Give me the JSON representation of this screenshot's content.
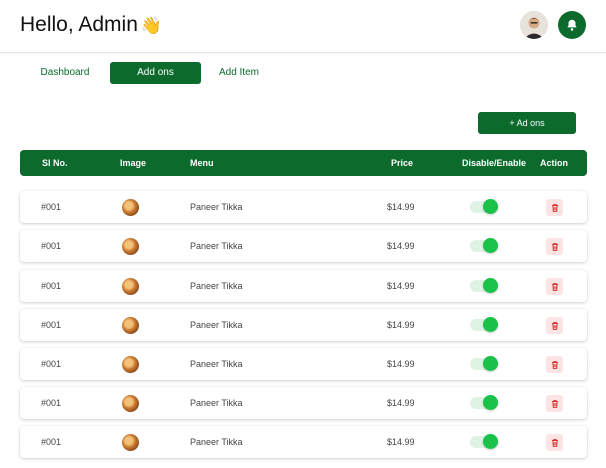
{
  "header": {
    "greeting": "Hello, Admin",
    "wave_emoji": "👋"
  },
  "tabs": [
    {
      "label": "Dashboard",
      "active": false
    },
    {
      "label": "Add ons",
      "active": true
    },
    {
      "label": "Add Item",
      "active": false
    }
  ],
  "toolbar": {
    "add_label": "+  Ad ons"
  },
  "table": {
    "columns": [
      "Sl No.",
      "Image",
      "Menu",
      "Price",
      "Disable/Enable",
      "Action"
    ],
    "rows": [
      {
        "id": "#001",
        "menu": "Paneer Tikka",
        "price": "$14.99",
        "enabled": true
      },
      {
        "id": "#001",
        "menu": "Paneer Tikka",
        "price": "$14.99",
        "enabled": true
      },
      {
        "id": "#001",
        "menu": "Paneer Tikka",
        "price": "$14.99",
        "enabled": true
      },
      {
        "id": "#001",
        "menu": "Paneer Tikka",
        "price": "$14.99",
        "enabled": true
      },
      {
        "id": "#001",
        "menu": "Paneer Tikka",
        "price": "$14.99",
        "enabled": true
      },
      {
        "id": "#001",
        "menu": "Paneer Tikka",
        "price": "$14.99",
        "enabled": true
      },
      {
        "id": "#001",
        "menu": "Paneer Tikka",
        "price": "$14.99",
        "enabled": true
      }
    ]
  },
  "icons": {
    "bell": "bell-icon",
    "avatar": "user-avatar",
    "row_image": "food-thumbnail",
    "delete": "trash-icon"
  },
  "colors": {
    "brand_green": "#0b6a2c",
    "toggle_on": "#1bc24a",
    "toggle_track": "#dff3e4",
    "delete_icon": "#d63030",
    "delete_bg": "#fde4e4"
  }
}
